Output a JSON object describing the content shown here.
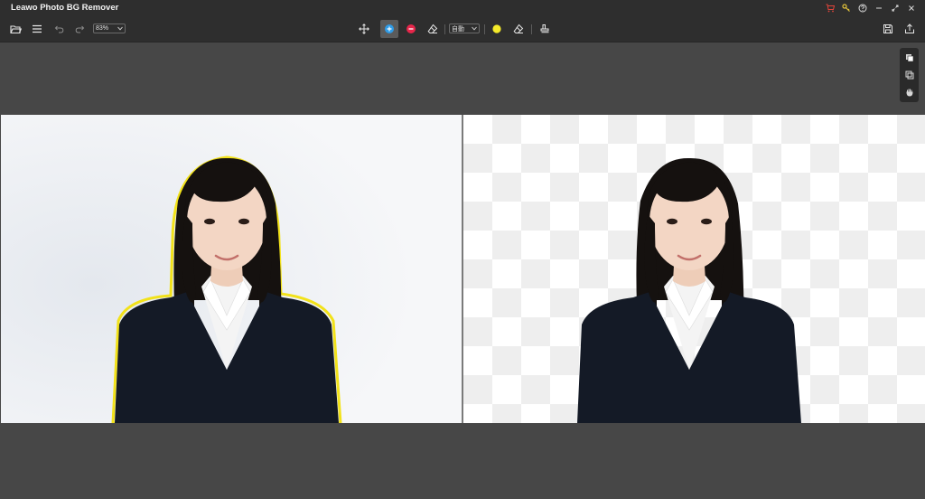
{
  "app": {
    "title": "Leawo Photo BG Remover"
  },
  "window_controls": [
    {
      "name": "cart-icon",
      "glyph": "🛒",
      "color": "#e0443a"
    },
    {
      "name": "key-icon",
      "glyph": "⚷",
      "color": "#e2c23b"
    },
    {
      "name": "help-icon",
      "glyph": "?",
      "color": "#d8d8d8"
    },
    {
      "name": "minimize-icon",
      "glyph": "–",
      "color": "#d8d8d8"
    },
    {
      "name": "restore-icon",
      "glyph": "⤢",
      "color": "#d8d8d8"
    },
    {
      "name": "close-icon",
      "glyph": "✕",
      "color": "#d8d8d8"
    }
  ],
  "toolbar": {
    "zoom_value": "83%",
    "mode_value": "自動",
    "colors": {
      "keep": "#2f9be6",
      "remove": "#e6264a",
      "highlight": "#f4ea2a"
    }
  },
  "canvas": {
    "original_bg": "#f3f5f8",
    "selection_outline": "#f2e21a"
  }
}
